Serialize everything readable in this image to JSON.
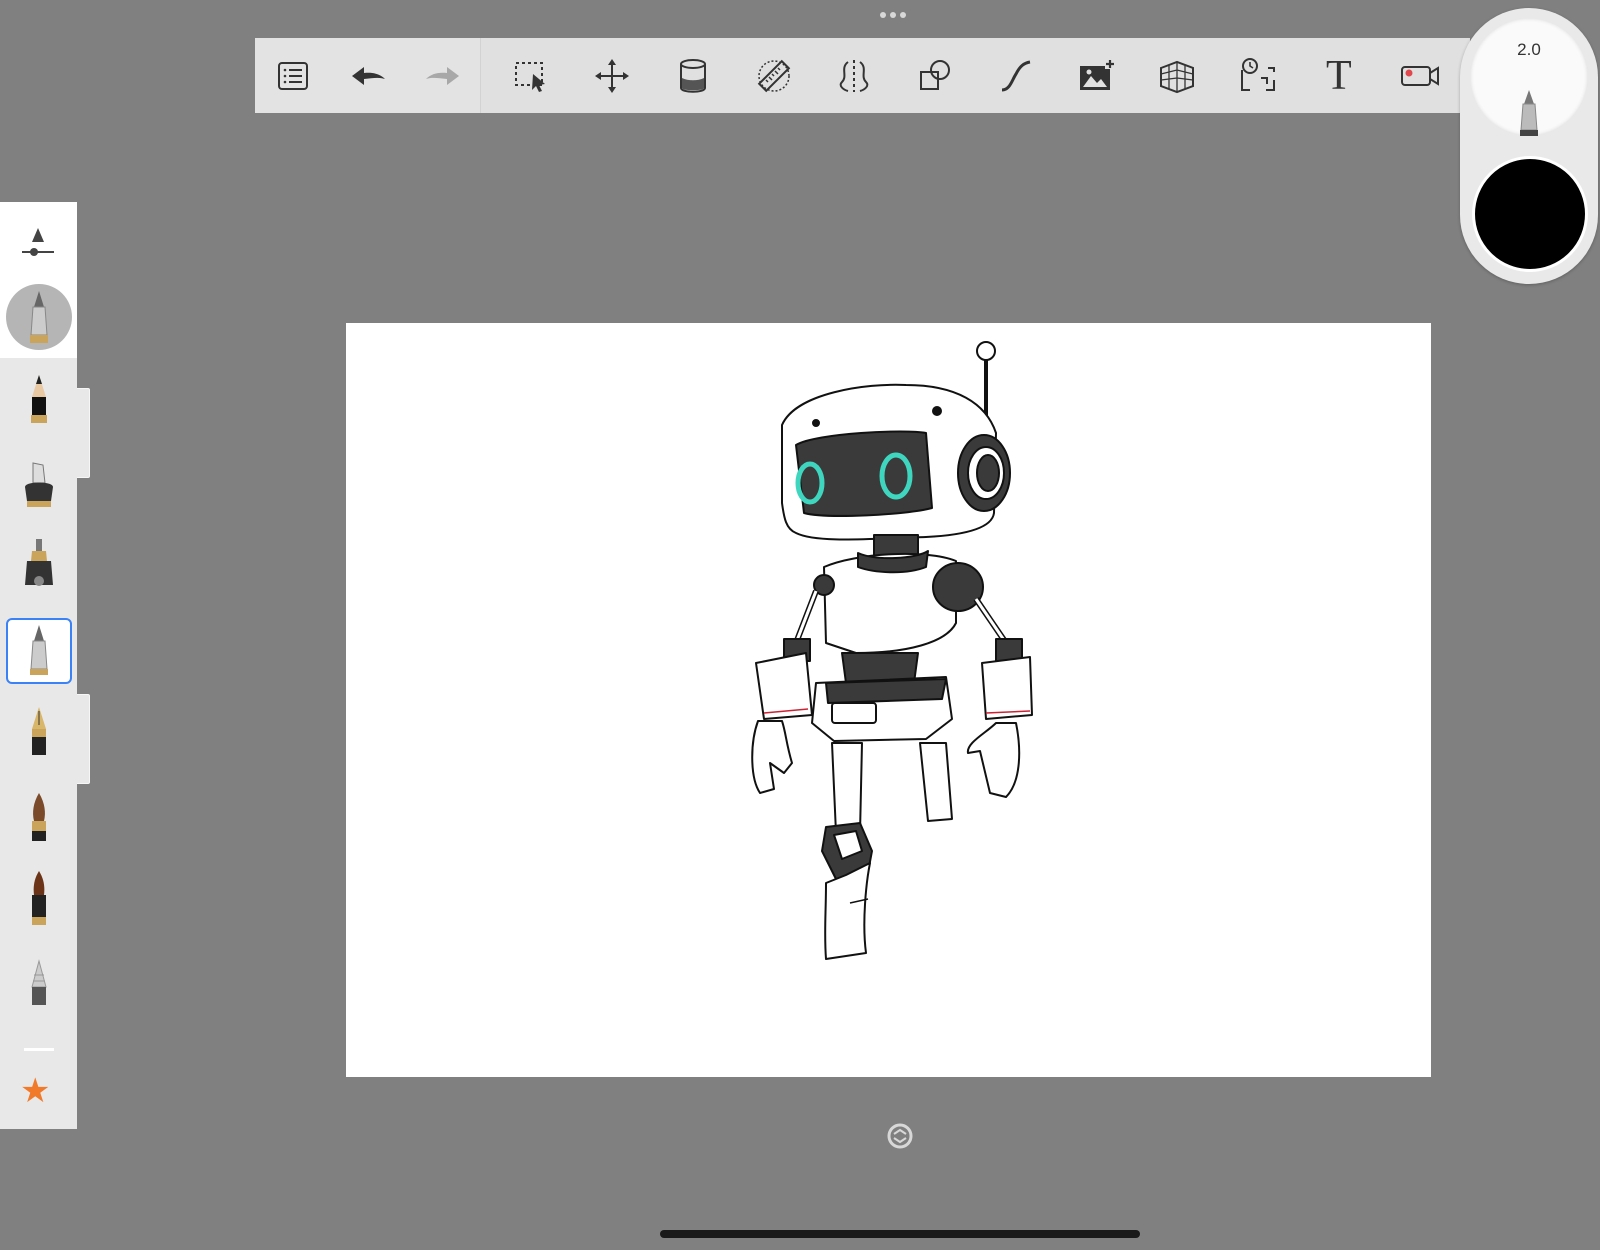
{
  "app": {
    "toolbar": {
      "left_tools": [
        {
          "icon": "list-icon",
          "name": "layers-menu-button"
        },
        {
          "icon": "undo-icon",
          "name": "undo-button"
        },
        {
          "icon": "redo-icon",
          "name": "redo-button"
        }
      ],
      "right_tools": [
        {
          "icon": "selection-icon",
          "name": "selection-tool-button"
        },
        {
          "icon": "transform-icon",
          "name": "transform-tool-button"
        },
        {
          "icon": "fill-bucket-icon",
          "name": "fill-tool-button"
        },
        {
          "icon": "ruler-icon",
          "name": "ruler-tool-button"
        },
        {
          "icon": "symmetry-icon",
          "name": "symmetry-tool-button"
        },
        {
          "icon": "shapes-icon",
          "name": "shapes-tool-button"
        },
        {
          "icon": "curve-icon",
          "name": "curve-tool-button"
        },
        {
          "icon": "add-image-icon",
          "name": "add-image-button"
        },
        {
          "icon": "perspective-icon",
          "name": "perspective-guide-button"
        },
        {
          "icon": "time-lapse-icon",
          "name": "time-lapse-button"
        },
        {
          "icon": "text-icon",
          "name": "text-tool-button"
        },
        {
          "icon": "record-icon",
          "name": "record-button"
        }
      ],
      "text_tool_glyph": "T"
    },
    "puck": {
      "brush_size": "2.0",
      "color": "#000000"
    },
    "brush_library": {
      "active_brush_icon": "technical-pen-icon",
      "brushes": [
        {
          "icon": "pencil-icon",
          "selected": false
        },
        {
          "icon": "marker-icon",
          "selected": false
        },
        {
          "icon": "airbrush-icon",
          "selected": false
        },
        {
          "icon": "technical-pen-icon",
          "selected": true
        },
        {
          "icon": "fountain-pen-icon",
          "selected": false
        },
        {
          "icon": "paint-brush-icon",
          "selected": false
        },
        {
          "icon": "ink-brush-icon",
          "selected": false
        },
        {
          "icon": "chisel-icon",
          "selected": false
        }
      ],
      "favorites_icon": "star-icon",
      "favorites_glyph": "★"
    },
    "canvas": {
      "background": "#ffffff",
      "drawing_subject": "robot",
      "eye_color": "#3fd6c0",
      "dark_fill": "#3a3a3a"
    }
  }
}
